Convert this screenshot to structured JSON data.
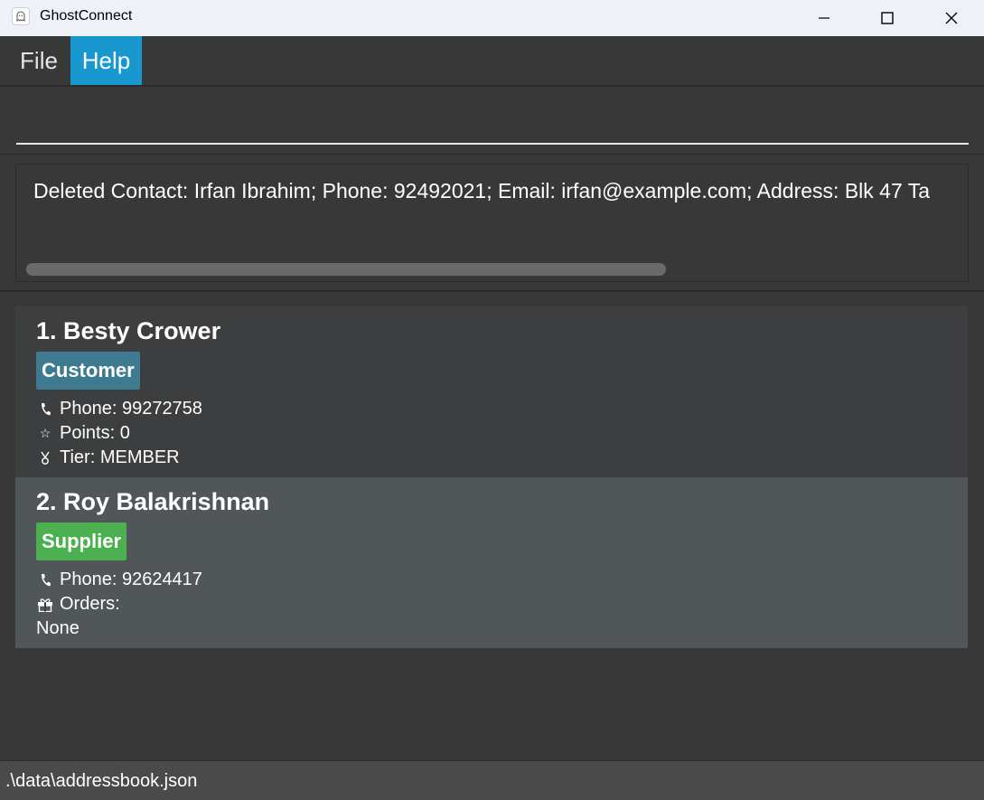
{
  "window": {
    "title": "GhostConnect"
  },
  "menu": {
    "file": "File",
    "help": "Help"
  },
  "command": {
    "value": "",
    "placeholder": ""
  },
  "result": {
    "message": "Deleted Contact: Irfan Ibrahim; Phone: 92492021; Email: irfan@example.com; Address: Blk 47 Ta"
  },
  "persons": [
    {
      "name": "1. Besty Crower",
      "tag": "Customer",
      "phone": "Phone: 99272758",
      "points": "Points: 0",
      "tier": "Tier: MEMBER"
    },
    {
      "name": "2. Roy Balakrishnan",
      "tag": "Supplier",
      "phone": "Phone: 92624417",
      "orders": "Orders:",
      "orders_value": "None"
    }
  ],
  "status": {
    "path": ".\\data\\addressbook.json"
  },
  "icons": {
    "app": "ghost-icon",
    "minimize": "minimize-icon",
    "maximize": "maximize-icon",
    "close": "close-icon",
    "phone": "phone-icon",
    "points": "star-icon",
    "tier": "medal-icon",
    "orders": "gift-icon"
  },
  "colors": {
    "accent": "#1998cf",
    "customer_tag": "#3e7b91",
    "supplier_tag": "#4caf50",
    "background": "#383838"
  }
}
